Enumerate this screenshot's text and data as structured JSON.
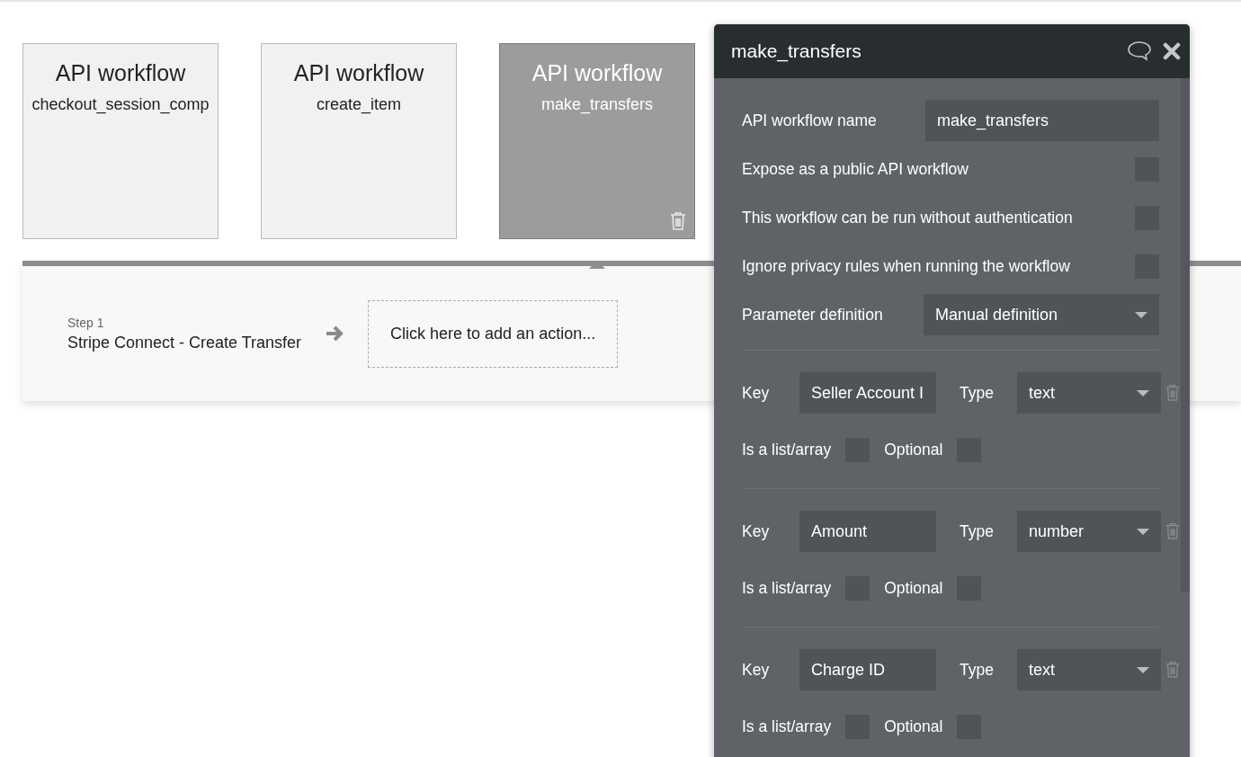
{
  "workflows": [
    {
      "title": "API workflow",
      "name": "checkout_session_comp",
      "selected": false
    },
    {
      "title": "API workflow",
      "name": "create_item",
      "selected": false
    },
    {
      "title": "API workflow",
      "name": "make_transfers",
      "selected": true
    }
  ],
  "steps": [
    {
      "label": "Step 1",
      "action": "Stripe Connect - Create Transfer"
    }
  ],
  "add_action": {
    "placeholder": "Click here to add an action..."
  },
  "dialog": {
    "title": "make_transfers",
    "name_field": {
      "label": "API workflow name",
      "value": "make_transfers"
    },
    "options": [
      {
        "label": "Expose as a public API workflow",
        "checked": false
      },
      {
        "label": "This workflow can be run without authentication",
        "checked": false
      },
      {
        "label": "Ignore privacy rules when running the workflow",
        "checked": false
      }
    ],
    "parameter_definition": {
      "label": "Parameter definition",
      "value": "Manual definition"
    },
    "parameters": [
      {
        "key_label": "Key",
        "key": "Seller Account I",
        "type_label": "Type",
        "type": "text",
        "list_label": "Is a list/array",
        "is_list": false,
        "optional_label": "Optional",
        "optional": false
      },
      {
        "key_label": "Key",
        "key": "Amount",
        "type_label": "Type",
        "type": "number",
        "list_label": "Is a list/array",
        "is_list": false,
        "optional_label": "Optional",
        "optional": false
      },
      {
        "key_label": "Key",
        "key": "Charge ID",
        "type_label": "Type",
        "type": "text",
        "list_label": "Is a list/array",
        "is_list": false,
        "optional_label": "Optional",
        "optional": false
      }
    ]
  }
}
